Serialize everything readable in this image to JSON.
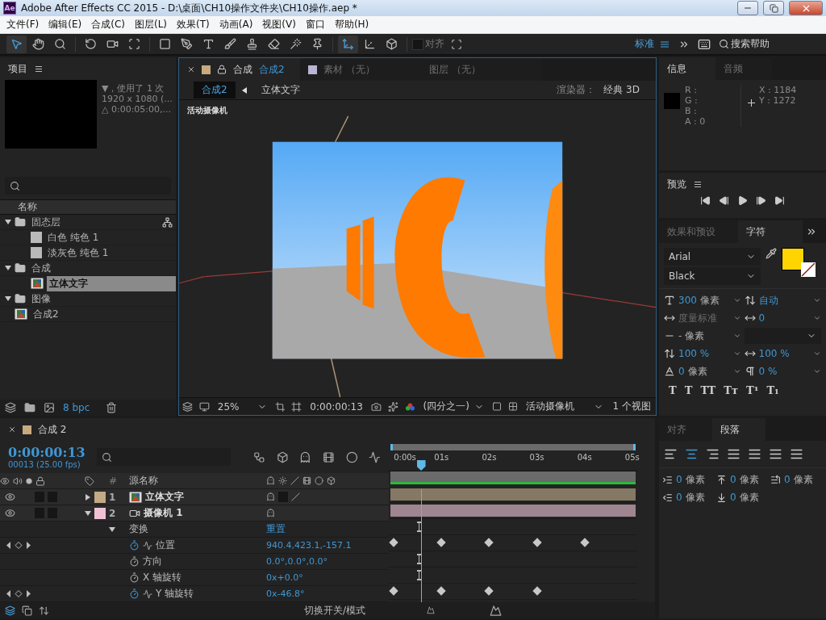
{
  "title_bar": {
    "app_icon": "Ae",
    "title": "Adobe After Effects CC 2015 - D:\\桌面\\CH10操作文件夹\\CH10操作.aep *"
  },
  "menu": [
    "文件(F)",
    "编辑(E)",
    "合成(C)",
    "图层(L)",
    "效果(T)",
    "动画(A)",
    "视图(V)",
    "窗口",
    "帮助(H)"
  ],
  "toolbar": {
    "tools": [
      {
        "kind": "select",
        "selected": true
      },
      {
        "kind": "hand",
        "selected": false
      },
      {
        "kind": "zoom",
        "selected": false
      },
      {
        "kind": "rotate",
        "selected": false
      },
      {
        "kind": "camera",
        "selected": false
      },
      {
        "kind": "pan",
        "selected": false
      },
      {
        "kind": "rect",
        "selected": false
      },
      {
        "kind": "pen",
        "selected": false
      },
      {
        "kind": "type",
        "selected": false
      },
      {
        "kind": "brush",
        "selected": false
      },
      {
        "kind": "stamp",
        "selected": false
      },
      {
        "kind": "eraser",
        "selected": false
      },
      {
        "kind": "roto",
        "selected": false
      },
      {
        "kind": "pin",
        "selected": false
      },
      {
        "kind": "local-axis",
        "selected": true
      },
      {
        "kind": "world-axis",
        "selected": false
      },
      {
        "kind": "view-axis",
        "selected": false
      }
    ],
    "snap_label": "对齐",
    "snap_checked": false,
    "workspace": "标准",
    "search": "搜索帮助"
  },
  "project": {
    "title": "项目",
    "info": [
      "▼，使用了 1 次",
      "1920 x 1080 (...",
      "△ 0:00:05:00,..."
    ],
    "column": "名称",
    "items": [
      {
        "kind": "folder",
        "name": "固态层",
        "expanded": true,
        "selected": false,
        "children": [
          {
            "kind": "solid",
            "name": "白色 纯色 1",
            "selected": false
          },
          {
            "kind": "solid",
            "name": "淡灰色 纯色 1",
            "selected": false
          }
        ]
      },
      {
        "kind": "folder",
        "name": "合成",
        "expanded": true,
        "selected": false,
        "children": [
          {
            "kind": "comp",
            "name": "立体文字",
            "selected": true
          }
        ]
      },
      {
        "kind": "folder",
        "name": "图像",
        "expanded": true,
        "selected": false
      },
      {
        "kind": "comp",
        "name": "合成2",
        "selected": false
      }
    ],
    "bit_depth": "8 bpc"
  },
  "viewer": {
    "tabs": [
      {
        "kind": "composition",
        "label": "合成",
        "sublabel": "合成2",
        "color": "#c8aa7e",
        "selected": true
      },
      {
        "kind": "footage",
        "label": "素材 （无）",
        "color": "#b9b4d6",
        "selected": false
      },
      {
        "kind": "layer",
        "label": "图层 （无）",
        "selected": false
      }
    ],
    "breadcrumbs": [
      {
        "label": "合成2",
        "selected": true
      },
      {
        "label": "立体文字",
        "selected": false
      }
    ],
    "renderer_label": "渲染器：",
    "renderer": "经典 3D",
    "view_label": "活动摄像机",
    "zoom": "25%",
    "timecode": "0:00:00:13",
    "resolution": "(四分之一)",
    "camera": "活动摄像机",
    "views": "1 个视图"
  },
  "info": {
    "tabs": [
      {
        "label": "信息",
        "selected": true
      },
      {
        "label": "音频",
        "selected": false
      }
    ],
    "channels": [
      "R :",
      "G :",
      "B :",
      "A : 0"
    ],
    "coords": [
      "X : 1184",
      "Y : 1272"
    ]
  },
  "preview": {
    "title": "预览"
  },
  "character": {
    "tabs": [
      {
        "label": "效果和预设",
        "selected": false
      },
      {
        "label": "字符",
        "selected": true
      }
    ],
    "font": "Arial",
    "style": "Black",
    "fields": [
      {
        "kind": "size",
        "value": "300",
        "unit": "像素"
      },
      {
        "kind": "leading",
        "value": "自动"
      },
      {
        "kind": "kerning",
        "unit": "度量标准"
      },
      {
        "kind": "tracking",
        "value": "0"
      },
      {
        "kind": "stroke",
        "unit": "- 像素"
      },
      {
        "kind": "blank"
      },
      {
        "kind": "vscale",
        "value": "100 %"
      },
      {
        "kind": "hscale",
        "value": "100 %"
      },
      {
        "kind": "baseline",
        "value": "0",
        "unit": "像素"
      },
      {
        "kind": "tsume",
        "value": "0 %"
      }
    ],
    "styles": [
      "T",
      "T",
      "TT",
      "Tт",
      "T¹",
      "T₁"
    ]
  },
  "timeline": {
    "tab": "合成 2",
    "timecode": "0:00:00:13",
    "frames": "00013 (25.00 fps)",
    "col_index": "#",
    "col_name": "源名称",
    "ticks": [
      "0:00s",
      "01s",
      "02s",
      "03s",
      "04s",
      "05s"
    ],
    "playhead": {
      "level": 0.104
    },
    "layers": [
      {
        "kind": "comp",
        "index": "1",
        "name": "立体文字",
        "color": "#c2ab86",
        "expanded": false,
        "visible": true
      },
      {
        "kind": "camera",
        "index": "2",
        "name": "摄像机 1",
        "color": "#efc3d4",
        "expanded": true,
        "visible": true
      }
    ],
    "group": {
      "name": "变换",
      "value": "重置",
      "expanded": true
    },
    "properties": [
      {
        "name": "位置",
        "value": "940.4,423.1,-157.1",
        "animated": true,
        "keyframes": [
          true,
          true,
          true,
          true,
          true,
          false
        ]
      },
      {
        "name": "方向",
        "value": "0.0°,0.0°,0.0°",
        "animated": false
      },
      {
        "name": "X 轴旋转",
        "value": "0x+0.0°",
        "animated": false
      },
      {
        "name": "Y 轴旋转",
        "value": "0x-46.8°",
        "animated": true,
        "keyframes": [
          true,
          true,
          true,
          true,
          false,
          false
        ]
      }
    ],
    "mode_toggle": "切换开关/模式"
  },
  "paragraph": {
    "tabs": [
      {
        "label": "对齐",
        "selected": false
      },
      {
        "label": "段落",
        "selected": true
      }
    ],
    "align": [
      {
        "kind": "left",
        "selected": false
      },
      {
        "kind": "center",
        "selected": true
      },
      {
        "kind": "right",
        "selected": false
      },
      {
        "kind": "justify-left",
        "selected": false
      },
      {
        "kind": "justify-center",
        "selected": false
      },
      {
        "kind": "justify-right",
        "selected": false
      },
      {
        "kind": "justify-all",
        "selected": false
      }
    ],
    "fields": [
      {
        "kind": "indent-left",
        "value": "0",
        "unit": "像素"
      },
      {
        "kind": "space-before",
        "value": "0",
        "unit": "像素"
      },
      {
        "kind": "first-line",
        "value": "0",
        "unit": "像素"
      },
      {
        "kind": "indent-right",
        "value": "0",
        "unit": "像素"
      },
      {
        "kind": "space-after",
        "value": "0",
        "unit": "像素"
      }
    ]
  }
}
